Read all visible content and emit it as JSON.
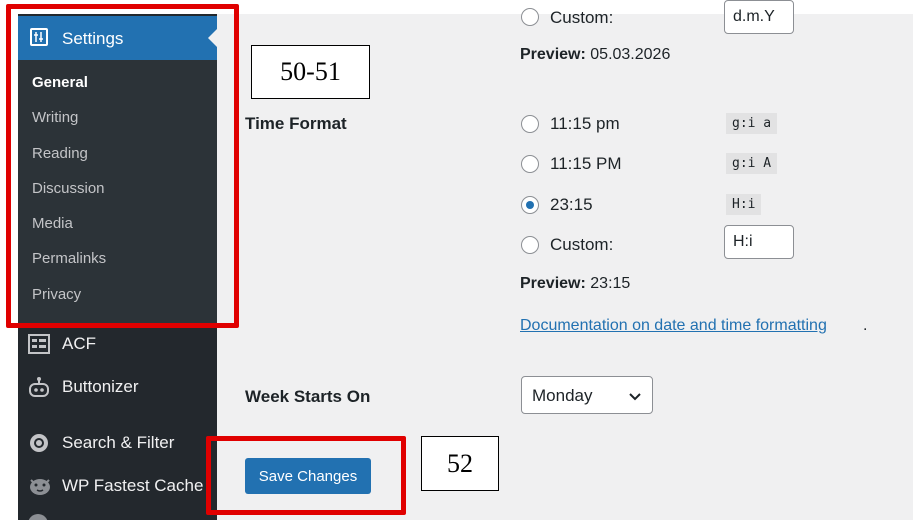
{
  "sidebar": {
    "settings_label": "Settings",
    "submenu": [
      {
        "label": "General",
        "active": true
      },
      {
        "label": "Writing",
        "active": false
      },
      {
        "label": "Reading",
        "active": false
      },
      {
        "label": "Discussion",
        "active": false
      },
      {
        "label": "Media",
        "active": false
      },
      {
        "label": "Permalinks",
        "active": false
      },
      {
        "label": "Privacy",
        "active": false
      }
    ],
    "plugins": [
      {
        "label": "ACF",
        "icon": "acf-grid-icon"
      },
      {
        "label": "Buttonizer",
        "icon": "buttonizer-robot-icon"
      },
      {
        "label": "Search & Filter",
        "icon": "search-filter-icon"
      },
      {
        "label": "WP Fastest Cache",
        "icon": "cheetah-icon"
      }
    ]
  },
  "date_format": {
    "custom_label": "Custom:",
    "custom_value": "d.m.Y",
    "preview_label": "Preview:",
    "preview_value": "05.03.2026"
  },
  "time_format": {
    "label": "Time Format",
    "options": [
      {
        "label": "11:15 pm",
        "code": "g:i a",
        "checked": false
      },
      {
        "label": "11:15 PM",
        "code": "g:i A",
        "checked": false
      },
      {
        "label": "23:15",
        "code": "H:i",
        "checked": true
      }
    ],
    "custom_label": "Custom:",
    "custom_value": "H:i",
    "preview_label": "Preview:",
    "preview_value": "23:15",
    "doc_link": "Documentation on date and time formatting",
    "doc_period": "."
  },
  "week_starts": {
    "label": "Week Starts On",
    "selected": "Monday"
  },
  "save_button": "Save Changes",
  "annotations": {
    "label_top": "50-51",
    "label_bottom": "52"
  },
  "colors": {
    "primary": "#2271b1",
    "sidebar_bg": "#23282d",
    "content_bg": "#f0f0f1",
    "annotation_red": "#e00000"
  }
}
